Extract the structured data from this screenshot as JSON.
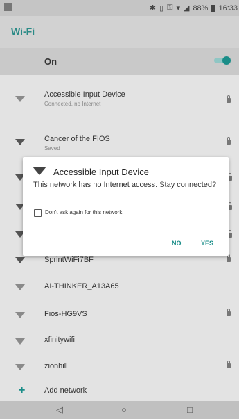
{
  "status": {
    "battery": "88%",
    "time": "16:33",
    "icons": [
      "bluetooth-icon",
      "vibrate-icon",
      "key-icon",
      "wifi-icon",
      "signal-icon",
      "battery-icon"
    ]
  },
  "appbar": {
    "title": "Wi-Fi"
  },
  "toggle": {
    "label": "On",
    "state": "on"
  },
  "networks": [
    {
      "name": "Accessible Input Device",
      "sub": "Connected, no Internet",
      "icon": "wifi-icon",
      "locked": true
    },
    {
      "name": "Cancer of the FIOS",
      "sub": "Saved",
      "icon": "wifi-icon",
      "locked": true
    },
    {
      "name": "SprintWiFi7BF",
      "sub": "",
      "icon": "wifi-icon",
      "locked": true
    },
    {
      "name": "AI-THINKER_A13A65",
      "sub": "",
      "icon": "wifi-icon",
      "locked": false
    },
    {
      "name": "Fios-HG9VS",
      "sub": "",
      "icon": "wifi-icon",
      "locked": true
    },
    {
      "name": "xfinitywifi",
      "sub": "",
      "icon": "wifi-icon",
      "locked": false
    },
    {
      "name": "zionhill",
      "sub": "",
      "icon": "wifi-icon",
      "locked": true
    }
  ],
  "add_network": {
    "label": "Add network",
    "icon": "plus-icon"
  },
  "dialog": {
    "title": "Accessible Input Device",
    "message": "This network has no Internet access. Stay connected?",
    "checkbox_label": "Don't ask again for this network",
    "checkbox_checked": false,
    "no_label": "NO",
    "yes_label": "YES"
  },
  "nav": {
    "back": "◁",
    "home": "○",
    "recents": "□"
  },
  "colors": {
    "accent": "#1a8d88"
  }
}
